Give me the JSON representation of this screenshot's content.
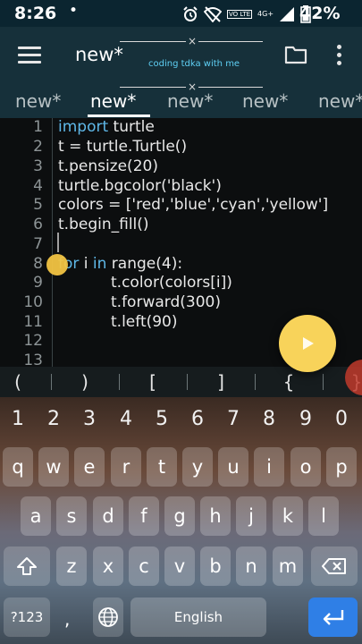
{
  "status_bar": {
    "time": "8:26",
    "notification_dot": "•",
    "lte_label": "VO LTE",
    "network_label": "4G+",
    "battery_percent": "42%"
  },
  "toolbar": {
    "title": "new*",
    "menu_icon": "hamburger-menu-icon",
    "folder_icon": "folder-icon",
    "more_icon": "more-vert-icon"
  },
  "overlay": {
    "caption": "coding tdka with me"
  },
  "tabs": [
    {
      "label": "new*",
      "active": false
    },
    {
      "label": "new*",
      "active": true
    },
    {
      "label": "new*",
      "active": false
    },
    {
      "label": "new*",
      "active": false
    },
    {
      "label": "new*",
      "active": false
    }
  ],
  "editor": {
    "line_numbers": [
      "1",
      "2",
      "3",
      "4",
      "5",
      "6",
      "7",
      "8",
      "9",
      "10",
      "11",
      "12",
      "13"
    ],
    "lines": {
      "l1_kw": "import",
      "l1_rest": " turtle",
      "l2": "t = turtle.Turtle()",
      "l3": "t.pensize(20)",
      "l4": "turtle.bgcolor('black')",
      "l5": "colors = ['red','blue','cyan','yellow']",
      "l6": "t.begin_fill()",
      "l8_kw1": "for",
      "l8_mid": " i ",
      "l8_kw2": "in",
      "l8_rest": " range(4):",
      "l9": "t.color(colors[i])",
      "l10": "t.forward(300)",
      "l11": "t.left(90)"
    },
    "run_icon": "play-icon"
  },
  "symbol_bar": {
    "symbols": [
      "(",
      ")",
      "[",
      "]",
      "{",
      "}"
    ]
  },
  "keyboard": {
    "number_row": [
      "1",
      "2",
      "3",
      "4",
      "5",
      "6",
      "7",
      "8",
      "9",
      "0"
    ],
    "row1": [
      "q",
      "w",
      "e",
      "r",
      "t",
      "y",
      "u",
      "i",
      "o",
      "p"
    ],
    "row2": [
      "a",
      "s",
      "d",
      "f",
      "g",
      "h",
      "j",
      "k",
      "l"
    ],
    "row3": [
      "z",
      "x",
      "c",
      "v",
      "b",
      "n",
      "m"
    ],
    "symbols_key": "?123",
    "comma_key": ",",
    "space_label": "English",
    "shift_icon": "shift-icon",
    "backspace_icon": "backspace-icon",
    "globe_icon": "globe-icon",
    "enter_icon": "enter-icon"
  },
  "colors": {
    "toolbar_bg": "#16303a",
    "editor_bg": "#0c0e0f",
    "keyword": "#5fb8e8",
    "run_button": "#f8d35a",
    "enter_key": "#2f7fe6"
  }
}
